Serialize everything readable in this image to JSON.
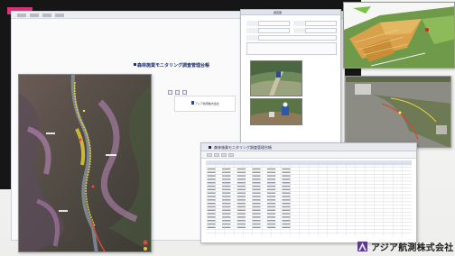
{
  "main_window": {
    "title_small": "",
    "title": "森林施業モニタリング調査管理台帳"
  },
  "center_logo": {
    "text": "アジア航測株式会社"
  },
  "form_window": {
    "title": "調査票"
  },
  "table_window": {
    "title": "森林施業モニタリング調査管理台帳",
    "columns": [
      "No",
      "調査日",
      "地区",
      "林班",
      "小班",
      "樹種",
      "面積",
      "本数",
      "状況",
      "備考"
    ]
  },
  "company": {
    "name": "アジア航測株式会社"
  },
  "colors": {
    "accent_magenta": "#d8317a",
    "brand_purple": "#5a3a8a",
    "title_blue": "#1b2f6b"
  }
}
